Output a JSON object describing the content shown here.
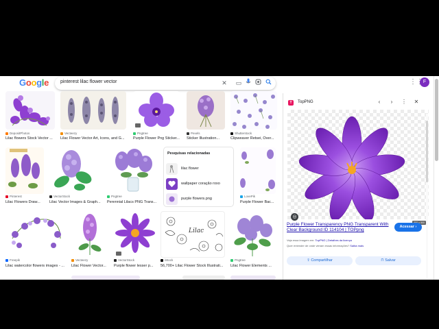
{
  "search": {
    "query": "pinterest lilac flower vector"
  },
  "logo": [
    "G",
    "o",
    "o",
    "g",
    "l",
    "e"
  ],
  "logo_colors": [
    "#4285f4",
    "#ea4335",
    "#fbbc05",
    "#4285f4",
    "#34a853",
    "#ea4335"
  ],
  "profile": {
    "initial": "F"
  },
  "results": {
    "row1": [
      {
        "source": "DepositPhotos",
        "title": "Lilac flowers Stock Vector ..."
      },
      {
        "source": "Vecteezy",
        "title": "Lilac Flower Vector Art, Icons, and G..."
      },
      {
        "source": "Pngtree",
        "title": "Purple Flower Png Sticker..."
      },
      {
        "source": "Pexels",
        "title": "Sticker Illustration..."
      },
      {
        "source": "Shutterstock",
        "title": "Clipweaver Retsei, Over..."
      }
    ],
    "row2": [
      {
        "source": "Pinterest",
        "title": "Lilac Flowers Draw..."
      },
      {
        "source": "VectorStock",
        "title": "Lilac Vector Images & Graph..."
      },
      {
        "source": "Pngtree",
        "title": "Perennial Lilacs PNG Trans..."
      },
      {
        "source": "LovePik",
        "title": "Purple Flower Bac..."
      }
    ],
    "row3": [
      {
        "source": "Freepik",
        "title": "Lilac watercolor flowers images - ..."
      },
      {
        "source": "Vecteezy",
        "title": "Lilac Flower Vector..."
      },
      {
        "source": "VectorStock",
        "title": "Purple flower lesser p..."
      },
      {
        "source": "iStock",
        "title": "56,700+ Lilac Flower Stock Illustrati..."
      },
      {
        "source": "Pngtree",
        "title": "Lilac Flower Elements ..."
      }
    ],
    "badge": "",
    "lineart_word": "Lilac"
  },
  "related": {
    "heading": "Pesquisas relacionadas",
    "items": [
      {
        "label": "lilac flower"
      },
      {
        "label": "wallpaper coração roxo"
      },
      {
        "label": "purple flowers.png"
      }
    ]
  },
  "panel": {
    "site": "TopPNG",
    "dims": "500 × 500",
    "title": "Purple Flower Transparency PNG Transparent With Clear Background ID 114104 | TOPpng",
    "visit": "Acessar",
    "note1_prefix": "Veja essa imagem em:",
    "note1_link": "TopPNG | Detalhes da licença",
    "note2_prefix": "Quer entender de onde vieram essas informações?",
    "note2_link": "Saiba mais",
    "share": "Compartilhar",
    "save": "Salvar"
  },
  "colors": {
    "accent": "#1a73e8",
    "link": "#1a0dab",
    "petal": "#8e3fd1",
    "petal_dark": "#6a1fb0",
    "center": "#f5a623",
    "profile": "#7b2cbf"
  },
  "icons": [
    "close-icon",
    "keyboard-icon",
    "mic-icon",
    "lens-icon",
    "search-icon",
    "apps-icon",
    "chevron-left-icon",
    "chevron-right-icon",
    "more-icon",
    "share-icon",
    "bookmark-icon"
  ]
}
